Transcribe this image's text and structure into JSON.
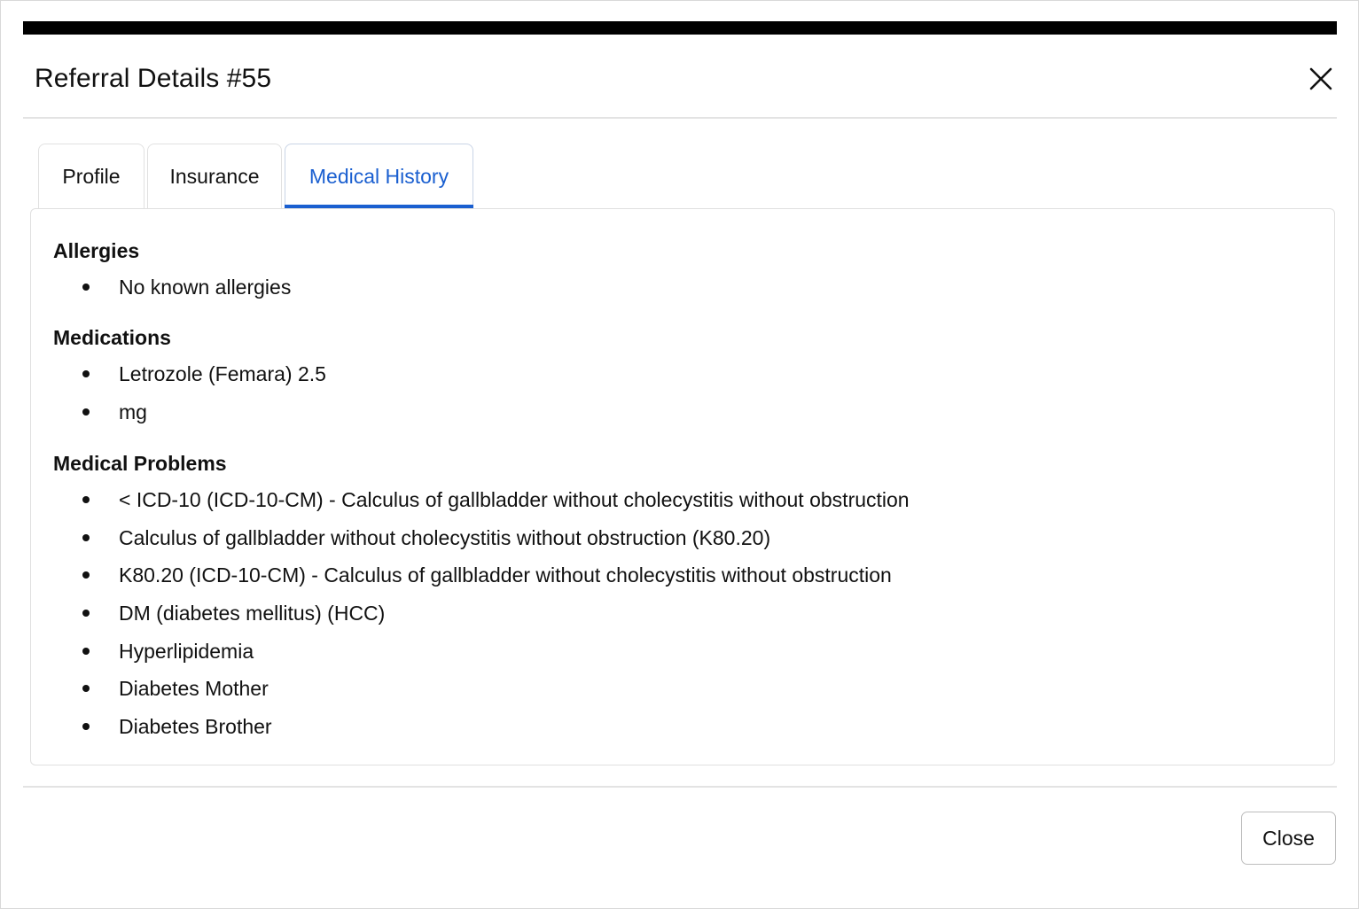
{
  "modal": {
    "title": "Referral Details #55",
    "close_icon": "close-icon"
  },
  "tabs": [
    {
      "label": "Profile",
      "active": false
    },
    {
      "label": "Insurance",
      "active": false
    },
    {
      "label": "Medical History",
      "active": true
    }
  ],
  "colors": {
    "accent": "#1a5fd0",
    "top_bar": "#000000"
  },
  "medical_history": {
    "allergies": {
      "heading": "Allergies",
      "items": [
        "No known allergies"
      ]
    },
    "medications": {
      "heading": "Medications",
      "items": [
        "Letrozole (Femara) 2.5",
        "mg"
      ]
    },
    "medical_problems": {
      "heading": "Medical Problems",
      "items": [
        "< ICD-10 (ICD-10-CM) - Calculus of gallbladder without cholecystitis without obstruction",
        "Calculus of gallbladder without cholecystitis without obstruction (K80.20)",
        "K80.20 (ICD-10-CM) - Calculus of gallbladder without cholecystitis without obstruction",
        "DM (diabetes mellitus) (HCC)",
        "Hyperlipidemia",
        "Diabetes Mother",
        "Diabetes Brother"
      ]
    }
  },
  "footer": {
    "close_label": "Close"
  }
}
